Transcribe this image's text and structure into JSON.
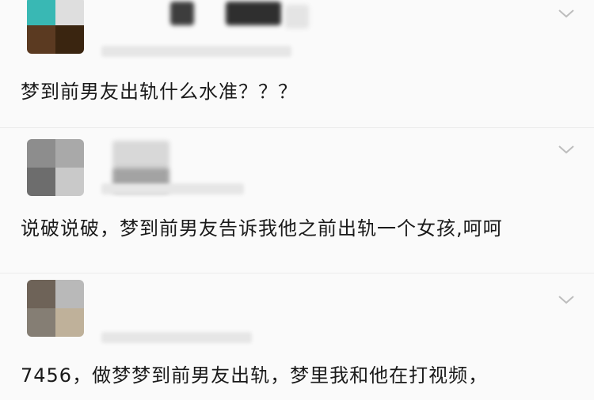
{
  "posts": [
    {
      "text": "梦到前男友出轨什么水准？？？",
      "avatar_colors": [
        "#39b8b4",
        "#dedede",
        "#5b3a21",
        "#3a2510"
      ]
    },
    {
      "text": "说破说破，梦到前男友告诉我他之前出轨一个女孩,呵呵",
      "avatar_colors": [
        "#8d8d8d",
        "#a9a9a9",
        "#6d6d6d",
        "#c9c9c9"
      ]
    },
    {
      "text": "7456，做梦梦到前男友出轨，梦里我和他在打视频，",
      "avatar_colors": [
        "#6e6358",
        "#b9b9b9",
        "#857e74",
        "#bfb19a"
      ]
    }
  ],
  "icons": {
    "expand": "chevron-down-icon"
  },
  "colors": {
    "background": "#fafafa",
    "text": "#1a1a1a",
    "chevron": "#bdbdbd"
  }
}
